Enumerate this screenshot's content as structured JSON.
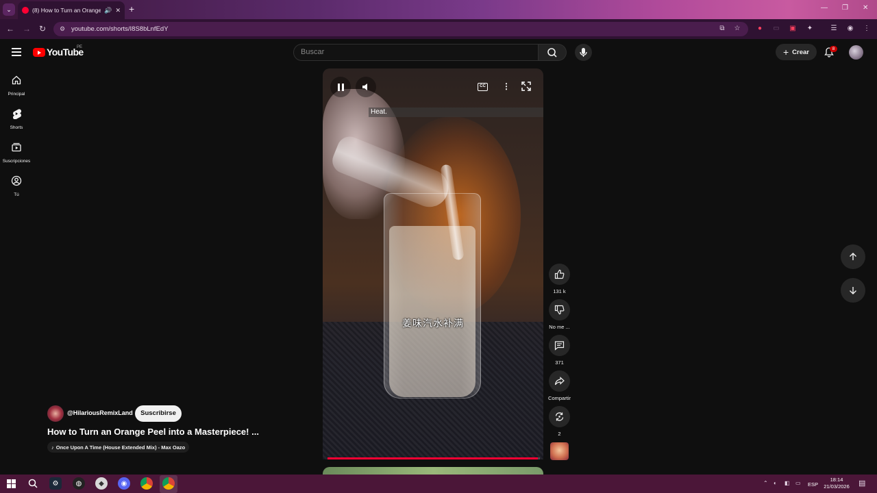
{
  "browser": {
    "tab_title": "(8) How to Turn an Orange",
    "url": "youtube.com/shorts/I8S8bLnfEdY"
  },
  "masthead": {
    "logo_text": "YouTube",
    "country_code": "PE",
    "search_placeholder": "Buscar",
    "create_label": "Crear",
    "notification_count": "8"
  },
  "sidebar": {
    "items": [
      {
        "label": "Principal",
        "icon": "home-icon"
      },
      {
        "label": "Shorts",
        "icon": "shorts-icon"
      },
      {
        "label": "Suscripciones",
        "icon": "subscriptions-icon"
      },
      {
        "label": "Tú",
        "icon": "you-icon"
      }
    ]
  },
  "video": {
    "caption": "Heat.",
    "overlay_subtitle": "姜味汽水补满",
    "progress": 0.99
  },
  "actions": {
    "likes": "131 k",
    "dislike_label": "No me ...",
    "comments": "371",
    "share_label": "Compartir",
    "remix_count": "2"
  },
  "channel": {
    "handle": "@HilariousRemixLand",
    "subscribe_label": "Suscribirse",
    "short_title": "How to Turn an Orange Peel into a Masterpiece! ...",
    "music": "Once Upon A Time (House Extended Mix) - Max Oazo"
  },
  "taskbar": {
    "language": "ESP",
    "time": "18:14",
    "date": "21/03/2026"
  },
  "colors": {
    "accent_red": "#ff0033",
    "browser_frame": "#2f1232",
    "taskbar": "#4b1638"
  }
}
